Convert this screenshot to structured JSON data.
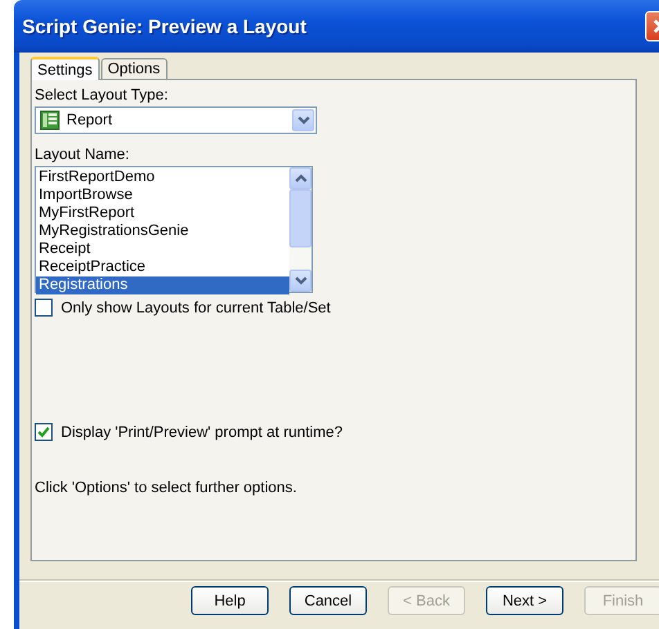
{
  "window": {
    "title": "Script Genie:  Preview a Layout"
  },
  "tabs": [
    {
      "label": "Settings",
      "selected": true
    },
    {
      "label": "Options",
      "selected": false
    }
  ],
  "layout_type": {
    "label": "Select Layout Type:",
    "value": "Report"
  },
  "layout_name": {
    "label": "Layout Name:",
    "items": [
      {
        "label": "FirstReportDemo",
        "selected": false
      },
      {
        "label": "ImportBrowse",
        "selected": false
      },
      {
        "label": "MyFirstReport",
        "selected": false
      },
      {
        "label": "MyRegistrationsGenie",
        "selected": false
      },
      {
        "label": "Receipt",
        "selected": false
      },
      {
        "label": "ReceiptPractice",
        "selected": false
      },
      {
        "label": "Registrations",
        "selected": true
      }
    ]
  },
  "only_current_table": {
    "label": "Only show Layouts for current Table/Set",
    "checked": false
  },
  "display_prompt": {
    "label": "Display 'Print/Preview' prompt at runtime?",
    "checked": true
  },
  "hint": "Click 'Options' to select further options.",
  "buttons": [
    {
      "label": "Help",
      "disabled": false
    },
    {
      "label": "Cancel",
      "disabled": false
    },
    {
      "label": "< Back",
      "disabled": true
    },
    {
      "label": "Next >",
      "disabled": false
    },
    {
      "label": "Finish",
      "disabled": true
    }
  ]
}
